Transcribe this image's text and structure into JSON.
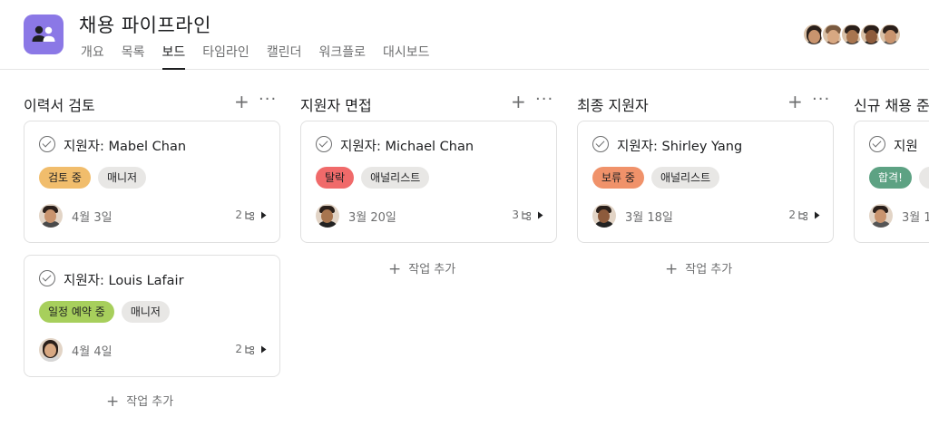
{
  "project": {
    "title": "채용 파이프라인",
    "icon": "people-icon",
    "accent": "#8b78e6"
  },
  "tabs": [
    {
      "label": "개요",
      "active": false
    },
    {
      "label": "목록",
      "active": false
    },
    {
      "label": "보드",
      "active": true
    },
    {
      "label": "타임라인",
      "active": false
    },
    {
      "label": "캘린더",
      "active": false
    },
    {
      "label": "워크플로",
      "active": false
    },
    {
      "label": "대시보드",
      "active": false
    }
  ],
  "columns": [
    {
      "title": "이력서 검토",
      "add_symbol": "+",
      "more_symbol": "···",
      "add_task": "작업 추가",
      "cards": [
        {
          "name": "지원자: Mabel Chan",
          "tags": [
            {
              "label": "검토 중",
              "color": "#f1bd6c"
            },
            {
              "label": "매니저",
              "color": "#e8e7e5"
            }
          ],
          "date": "4월 3일",
          "subtasks": "2"
        },
        {
          "name": "지원자: Louis Lafair",
          "tags": [
            {
              "label": "일정 예약 중",
              "color": "#a7cf5c"
            },
            {
              "label": "매니저",
              "color": "#e8e7e5"
            }
          ],
          "date": "4월 4일",
          "subtasks": "2"
        }
      ]
    },
    {
      "title": "지원자 면접",
      "add_symbol": "+",
      "more_symbol": "···",
      "add_task": "작업 추가",
      "cards": [
        {
          "name": "지원자: Michael Chan",
          "tags": [
            {
              "label": "탈락",
              "color": "#f06a6a"
            },
            {
              "label": "애널리스트",
              "color": "#e8e7e5"
            }
          ],
          "date": "3월 20일",
          "subtasks": "3"
        }
      ]
    },
    {
      "title": "최종 지원자",
      "add_symbol": "+",
      "more_symbol": "···",
      "add_task": "작업 추가",
      "cards": [
        {
          "name": "지원자: Shirley Yang",
          "tags": [
            {
              "label": "보류 중",
              "color": "#f0926a"
            },
            {
              "label": "애널리스트",
              "color": "#e8e7e5"
            }
          ],
          "date": "3월 18일",
          "subtasks": "2"
        }
      ]
    },
    {
      "title": "신규 채용 준",
      "cards": [
        {
          "name": "지원",
          "tags": [
            {
              "label": "합격!",
              "color": "#5da283"
            },
            {
              "label": "",
              "color": "#e8e7e5"
            }
          ],
          "date": "3월 1"
        }
      ]
    }
  ]
}
